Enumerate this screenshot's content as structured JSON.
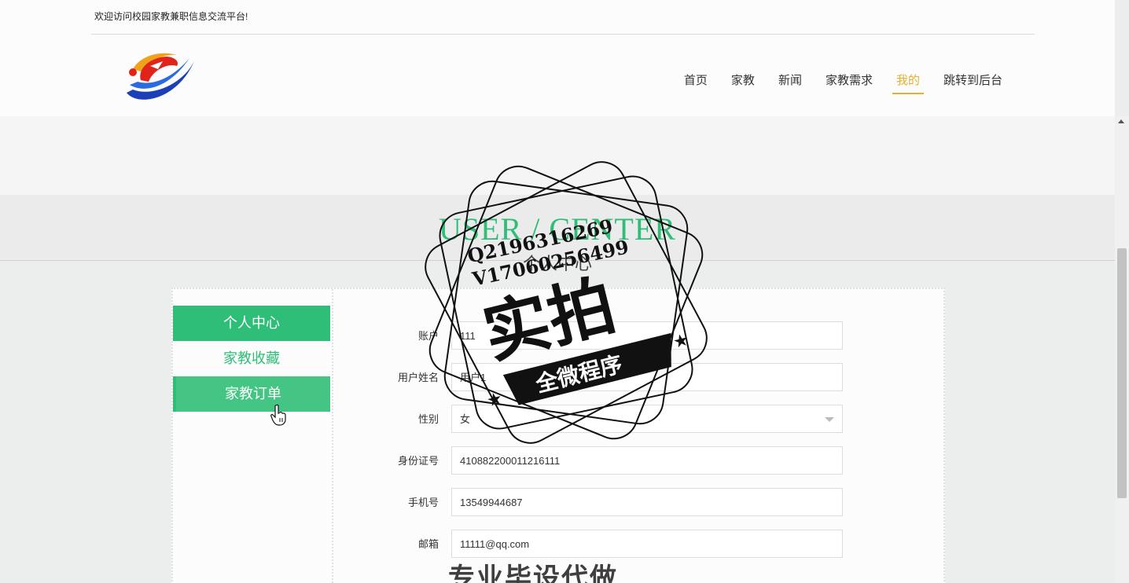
{
  "header": {
    "welcome": "欢迎访问校园家教兼职信息交流平台!",
    "nav": [
      {
        "label": "首页"
      },
      {
        "label": "家教"
      },
      {
        "label": "新闻"
      },
      {
        "label": "家教需求"
      },
      {
        "label": "我的",
        "active": true
      },
      {
        "label": "跳转到后台"
      }
    ]
  },
  "page_title": {
    "en": "USER / CENTER",
    "cn": "个人中心"
  },
  "sidebar": {
    "items": [
      {
        "label": "个人中心"
      },
      {
        "label": "家教收藏"
      },
      {
        "label": "家教订单"
      }
    ]
  },
  "form": {
    "fields": [
      {
        "label": "账户",
        "value": "111"
      },
      {
        "label": "用户姓名",
        "value": "用户1"
      },
      {
        "label": "性别",
        "value": "女"
      },
      {
        "label": "身份证号",
        "value": "410882200011216111"
      },
      {
        "label": "手机号",
        "value": "13549944687"
      },
      {
        "label": "邮箱",
        "value": "11111@qq.com"
      }
    ]
  },
  "watermark": {
    "line1": "Q2196316269",
    "line2": "V17060256499",
    "main": "实拍",
    "banner": "全微程序",
    "bottom": "专业毕设代做"
  },
  "colors": {
    "accent": "#2fbe78",
    "nav_active": "#e2b12d"
  }
}
